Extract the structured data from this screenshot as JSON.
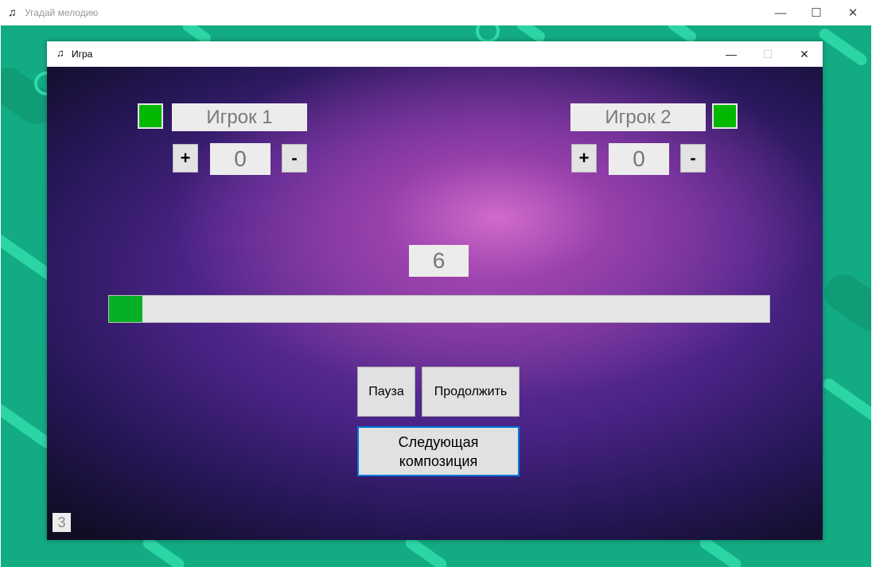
{
  "outer_window": {
    "title": "Угадай мелодию",
    "icon": "music-note-icon",
    "controls": {
      "minimize": "—",
      "maximize": "☐",
      "close": "✕"
    }
  },
  "game_window": {
    "title": "Игра",
    "icon": "music-note-icon",
    "controls": {
      "minimize": "—",
      "maximize": "☐",
      "close": "✕"
    }
  },
  "players": [
    {
      "name": "Игрок 1",
      "score": "0",
      "plus_label": "+",
      "minus_label": "-",
      "indicator_color": "#00b800"
    },
    {
      "name": "Игрок 2",
      "score": "0",
      "plus_label": "+",
      "minus_label": "-",
      "indicator_color": "#00b800"
    }
  ],
  "timer": "6",
  "progress": {
    "percent": 5
  },
  "buttons": {
    "pause": "Пауза",
    "resume": "Продолжить",
    "next": "Следующая\nкомпозиция"
  },
  "tracks_counter": "3",
  "colors": {
    "accent": "#06b025",
    "focus": "#0078d7"
  }
}
